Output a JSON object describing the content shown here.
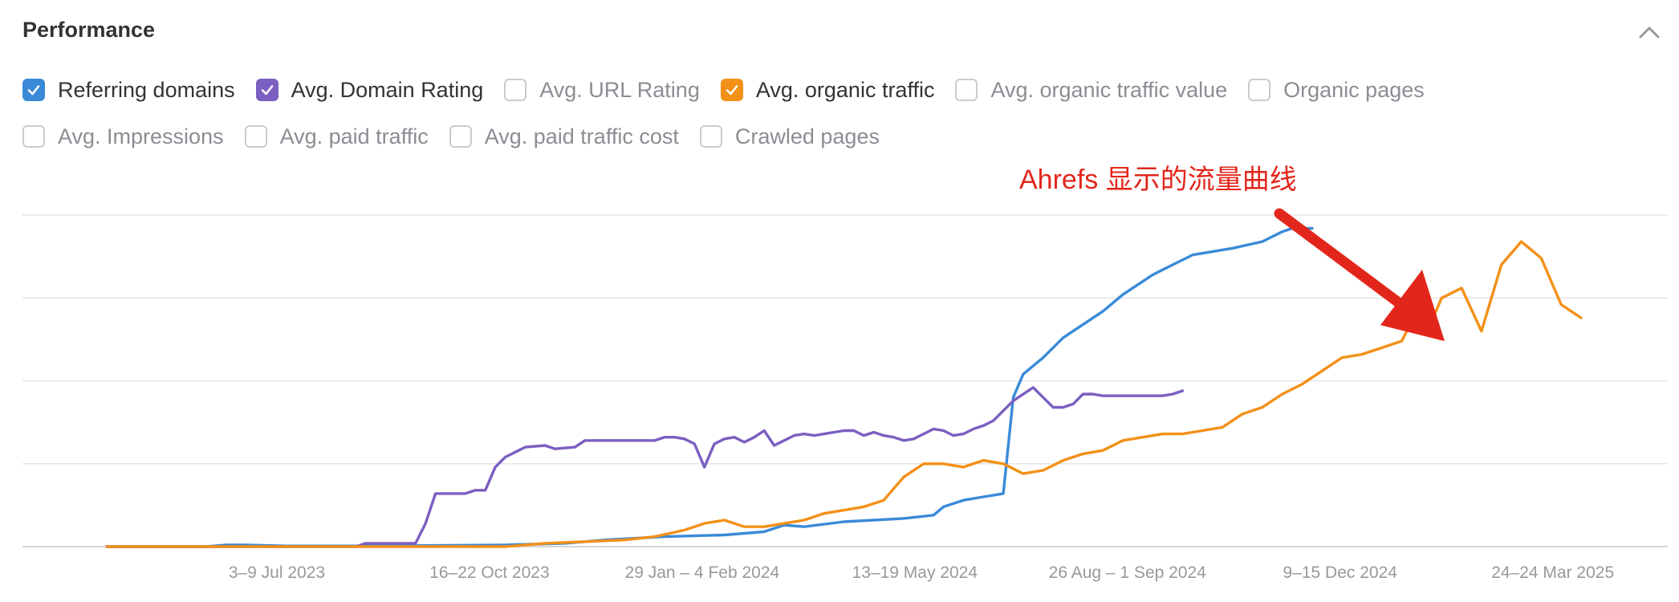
{
  "header": {
    "title": "Performance"
  },
  "filters": {
    "row1": [
      {
        "label": "Referring domains",
        "checked": true,
        "color": "#3a8ad8"
      },
      {
        "label": "Avg. Domain Rating",
        "checked": true,
        "color": "#7b5fc1"
      },
      {
        "label": "Avg. URL Rating",
        "checked": false,
        "color": ""
      },
      {
        "label": "Avg. organic traffic",
        "checked": true,
        "color": "#f39018"
      },
      {
        "label": "Avg. organic traffic value",
        "checked": false,
        "color": ""
      },
      {
        "label": "Organic pages",
        "checked": false,
        "color": ""
      }
    ],
    "row2": [
      {
        "label": "Avg. Impressions",
        "checked": false,
        "color": ""
      },
      {
        "label": "Avg. paid traffic",
        "checked": false,
        "color": ""
      },
      {
        "label": "Avg. paid traffic cost",
        "checked": false,
        "color": ""
      },
      {
        "label": "Crawled pages",
        "checked": false,
        "color": ""
      }
    ]
  },
  "annotation": {
    "text": "Ahrefs 显示的流量曲线",
    "color": "#e3261b"
  },
  "chart_data": {
    "type": "line",
    "x_tick_labels": [
      "3–9 Jul 2023",
      "16–22 Oct 2023",
      "29 Jan – 4 Feb 2024",
      "13–19 May 2024",
      "26 Aug – 1 Sep 2024",
      "9–15 Dec 2024",
      "24–24 Mar 2025"
    ],
    "x_tick_weeks": [
      12,
      27,
      42,
      57,
      72,
      87,
      102
    ],
    "x_range": [
      0,
      104
    ],
    "y_range": [
      0,
      100
    ],
    "y_axis_labels": "none",
    "grid": true,
    "gridline_count": 4,
    "series": [
      {
        "key": "referring_domains",
        "color": "#3a8ad8",
        "points": [
          [
            0,
            0
          ],
          [
            10,
            0
          ],
          [
            12,
            0.5
          ],
          [
            14,
            0.5
          ],
          [
            18,
            0.2
          ],
          [
            26,
            0.2
          ],
          [
            40,
            0.5
          ],
          [
            46,
            1
          ],
          [
            50,
            2
          ],
          [
            56,
            3
          ],
          [
            62,
            3.5
          ],
          [
            66,
            4.5
          ],
          [
            68,
            6.5
          ],
          [
            70,
            6
          ],
          [
            74,
            7.5
          ],
          [
            80,
            8.5
          ],
          [
            83,
            9.5
          ],
          [
            84,
            12
          ],
          [
            86,
            14
          ],
          [
            88,
            15
          ],
          [
            89,
            15.5
          ],
          [
            90,
            16
          ],
          [
            91,
            45
          ],
          [
            92,
            52
          ],
          [
            94,
            57
          ],
          [
            96,
            63
          ],
          [
            98,
            67
          ],
          [
            100,
            71
          ],
          [
            102,
            76
          ],
          [
            104,
            80
          ],
          [
            105,
            82
          ],
          [
            107,
            85
          ],
          [
            109,
            88
          ],
          [
            111,
            89
          ],
          [
            113,
            90
          ],
          [
            116,
            92
          ],
          [
            118,
            95
          ],
          [
            119,
            96
          ],
          [
            121,
            96
          ]
        ]
      },
      {
        "key": "avg_domain_rating",
        "color": "#7b5fc1",
        "points": [
          [
            0,
            0
          ],
          [
            25,
            0
          ],
          [
            26,
            1
          ],
          [
            31,
            1
          ],
          [
            32,
            7
          ],
          [
            33,
            16
          ],
          [
            36,
            16
          ],
          [
            37,
            17
          ],
          [
            38,
            17
          ],
          [
            39,
            24
          ],
          [
            40,
            27
          ],
          [
            41,
            28.5
          ],
          [
            42,
            30
          ],
          [
            44,
            30.5
          ],
          [
            45,
            29.5
          ],
          [
            47,
            30
          ],
          [
            48,
            32
          ],
          [
            55,
            32
          ],
          [
            56,
            33
          ],
          [
            57,
            33
          ],
          [
            58,
            32.5
          ],
          [
            59,
            31
          ],
          [
            60,
            24
          ],
          [
            61,
            31
          ],
          [
            62,
            32.5
          ],
          [
            63,
            33
          ],
          [
            64,
            31.5
          ],
          [
            65,
            33
          ],
          [
            66,
            35
          ],
          [
            67,
            30.5
          ],
          [
            68,
            32
          ],
          [
            69,
            33.5
          ],
          [
            70,
            34
          ],
          [
            71,
            33.5
          ],
          [
            72,
            34
          ],
          [
            73,
            34.5
          ],
          [
            74,
            35
          ],
          [
            75,
            35
          ],
          [
            76,
            33.5
          ],
          [
            77,
            34.5
          ],
          [
            78,
            33.5
          ],
          [
            79,
            33
          ],
          [
            80,
            32
          ],
          [
            81,
            32.5
          ],
          [
            82,
            34
          ],
          [
            83,
            35.5
          ],
          [
            84,
            35
          ],
          [
            85,
            33.5
          ],
          [
            86,
            34
          ],
          [
            87,
            35.5
          ],
          [
            88,
            36.5
          ],
          [
            89,
            38
          ],
          [
            90,
            41
          ],
          [
            91,
            44
          ],
          [
            92,
            46
          ],
          [
            93,
            48
          ],
          [
            94,
            45
          ],
          [
            95,
            42
          ],
          [
            96,
            42
          ],
          [
            97,
            43
          ],
          [
            98,
            46
          ],
          [
            99,
            46
          ],
          [
            100,
            45.5
          ],
          [
            101,
            45.5
          ],
          [
            106,
            45.5
          ],
          [
            107,
            46
          ],
          [
            108,
            47
          ]
        ]
      },
      {
        "key": "avg_organic_traffic",
        "color": "#f39018",
        "points": [
          [
            0,
            0
          ],
          [
            40,
            0
          ],
          [
            44,
            1
          ],
          [
            48,
            1.5
          ],
          [
            52,
            2
          ],
          [
            55,
            3
          ],
          [
            58,
            5
          ],
          [
            60,
            7
          ],
          [
            62,
            8
          ],
          [
            64,
            6
          ],
          [
            66,
            6
          ],
          [
            68,
            7
          ],
          [
            70,
            8
          ],
          [
            72,
            10
          ],
          [
            74,
            11
          ],
          [
            76,
            12
          ],
          [
            78,
            14
          ],
          [
            80,
            21
          ],
          [
            82,
            25
          ],
          [
            84,
            25
          ],
          [
            86,
            24
          ],
          [
            88,
            26
          ],
          [
            90,
            25
          ],
          [
            92,
            22
          ],
          [
            94,
            23
          ],
          [
            96,
            26
          ],
          [
            98,
            28
          ],
          [
            100,
            29
          ],
          [
            102,
            32
          ],
          [
            104,
            33
          ],
          [
            106,
            34
          ],
          [
            108,
            34
          ],
          [
            110,
            35
          ],
          [
            112,
            36
          ],
          [
            114,
            40
          ],
          [
            116,
            42
          ],
          [
            118,
            46
          ],
          [
            120,
            49
          ],
          [
            122,
            53
          ],
          [
            124,
            57
          ],
          [
            126,
            58
          ],
          [
            128,
            60
          ],
          [
            130,
            62
          ],
          [
            131,
            68
          ],
          [
            132,
            72
          ],
          [
            133,
            68
          ],
          [
            134,
            75
          ],
          [
            136,
            78
          ],
          [
            138,
            65
          ],
          [
            140,
            85
          ],
          [
            142,
            92
          ],
          [
            144,
            87
          ],
          [
            146,
            73
          ],
          [
            148,
            69
          ]
        ]
      }
    ]
  }
}
